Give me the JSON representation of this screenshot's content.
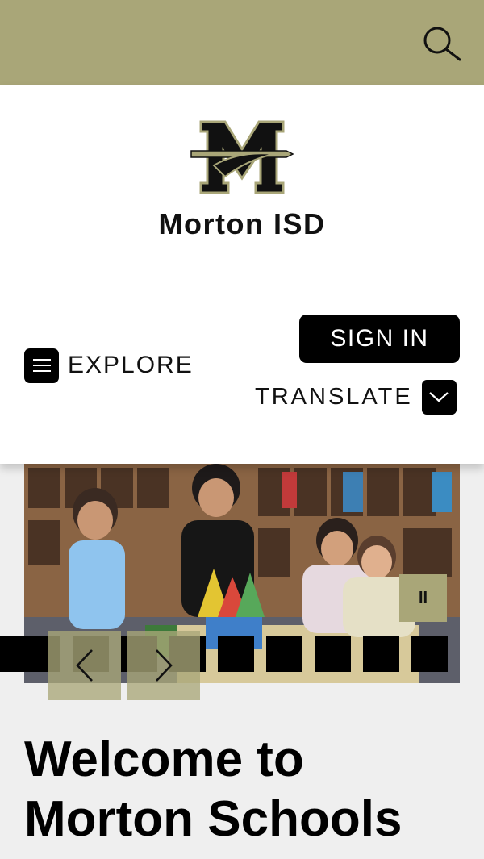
{
  "topbar": {
    "search_icon": "search-icon"
  },
  "header": {
    "logo_alt": "Morton ISD logo",
    "title": "Morton ISD",
    "explore_label": "EXPLORE",
    "sign_in_label": "SIGN IN",
    "translate_label": "TRANSLATE"
  },
  "slideshow": {
    "pause_glyph": "II",
    "prev_icon": "chevron-left-icon",
    "next_icon": "chevron-right-icon",
    "dot_count": 10
  },
  "main": {
    "welcome_line1": "Welcome to",
    "welcome_line2": "Morton Schools"
  },
  "colors": {
    "brand_gold": "#a9a678",
    "black": "#000000",
    "page_bg": "#efefef"
  }
}
